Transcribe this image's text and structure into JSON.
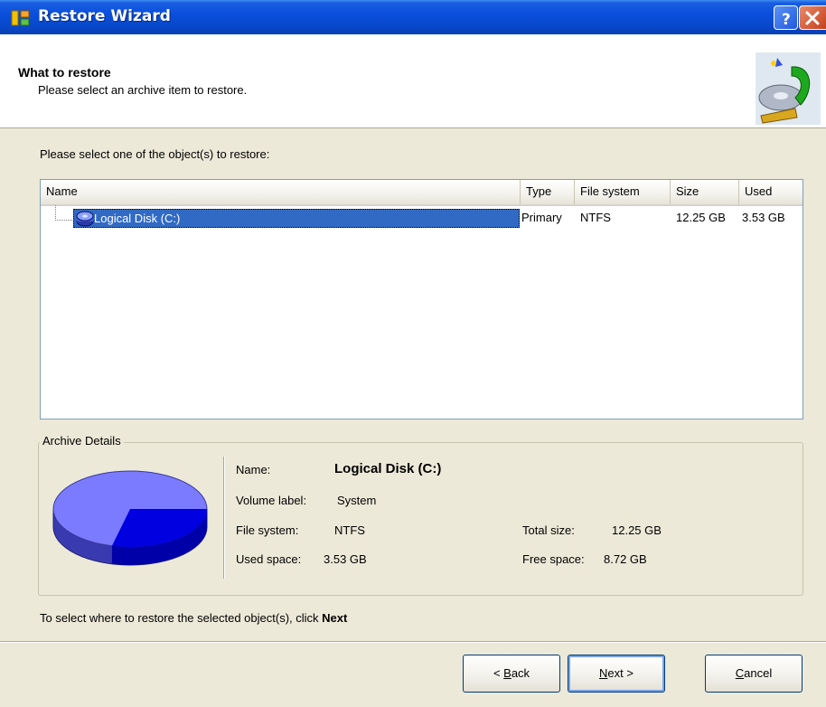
{
  "window": {
    "title": "Restore Wizard"
  },
  "header": {
    "title": "What to restore",
    "subtitle": "Please select an archive item to restore."
  },
  "instruction": "Please select one of the object(s) to restore:",
  "table": {
    "columns": [
      "Name",
      "Type",
      "File system",
      "Size",
      "Used"
    ],
    "rows": [
      {
        "name": "Logical Disk (C:)",
        "type": "Primary",
        "filesystem": "NTFS",
        "size": "12.25 GB",
        "used": "3.53 GB",
        "selected": true
      }
    ]
  },
  "details": {
    "legend": "Archive Details",
    "name_label": "Name:",
    "name_value": "Logical Disk (C:)",
    "volume_label_label": "Volume label:",
    "volume_label_value": "System",
    "filesystem_label": "File system:",
    "filesystem_value": "NTFS",
    "used_label": "Used space:",
    "used_value": "3.53 GB",
    "total_label": "Total size:",
    "total_value": "12.25 GB",
    "free_label": "Free space:",
    "free_value": "8.72 GB",
    "used_fraction": 0.288,
    "colors": {
      "free": "#7b7bff",
      "used": "#0000e0"
    }
  },
  "footer": {
    "note_prefix": "To select where to restore the selected object(s), click ",
    "note_bold": "Next"
  },
  "buttons": {
    "back_mnemonic": "B",
    "back_rest": "ack",
    "back_prefix": "< ",
    "next_mnemonic": "N",
    "next_rest": "ext >",
    "cancel_mnemonic": "C",
    "cancel_rest": "ancel"
  },
  "icons": {
    "app": "wizard-app-icon",
    "help": "help-icon",
    "close": "close-icon",
    "disk": "disk-icon",
    "header": "restore-wizard-icon"
  }
}
